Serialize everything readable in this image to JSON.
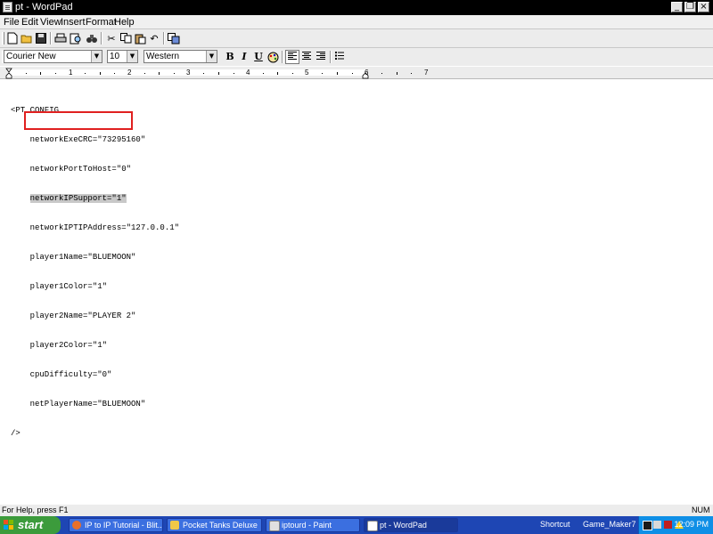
{
  "window": {
    "title": "pt - WordPad"
  },
  "menu": [
    "File",
    "Edit",
    "View",
    "Insert",
    "Format",
    "Help"
  ],
  "format_bar": {
    "font": "Courier New",
    "size": "10",
    "script": "Western",
    "bold": "B",
    "italic": "I",
    "underline": "U"
  },
  "ruler": {
    "numbers": [
      "1",
      "2",
      "3",
      "4",
      "5",
      "6",
      "7"
    ]
  },
  "document": {
    "lines": [
      "<PT_CONFIG",
      "    networkExeCRC=\"73295160\"",
      "    networkPortToHost=\"0\"",
      "    networkIPSupport=\"1\"",
      "    networkIPTIPAddress=\"127.0.0.1\"",
      "    player1Name=\"BLUEMOON\"",
      "    player1Color=\"1\"",
      "    player2Name=\"PLAYER 2\"",
      "    player2Color=\"1\"",
      "    cpuDifficulty=\"0\"",
      "    netPlayerName=\"BLUEMOON\"",
      "/>"
    ],
    "selected_line": "networkIPSupport=\"1\""
  },
  "status": {
    "text": "For Help, press F1",
    "indicator": "NUM"
  },
  "taskbar": {
    "start": "start",
    "tasks": [
      {
        "label": "IP to IP Tutorial - Blit...",
        "icon": "firefox-icon"
      },
      {
        "label": "Pocket Tanks Deluxe",
        "icon": "folder-icon"
      },
      {
        "label": "iptourd - Paint",
        "icon": "paint-icon"
      },
      {
        "label": "pt - WordPad",
        "icon": "wordpad-icon"
      }
    ],
    "shortcuts": [
      "Shortcut",
      "Game_Maker7"
    ],
    "clock": "12:09 PM"
  }
}
